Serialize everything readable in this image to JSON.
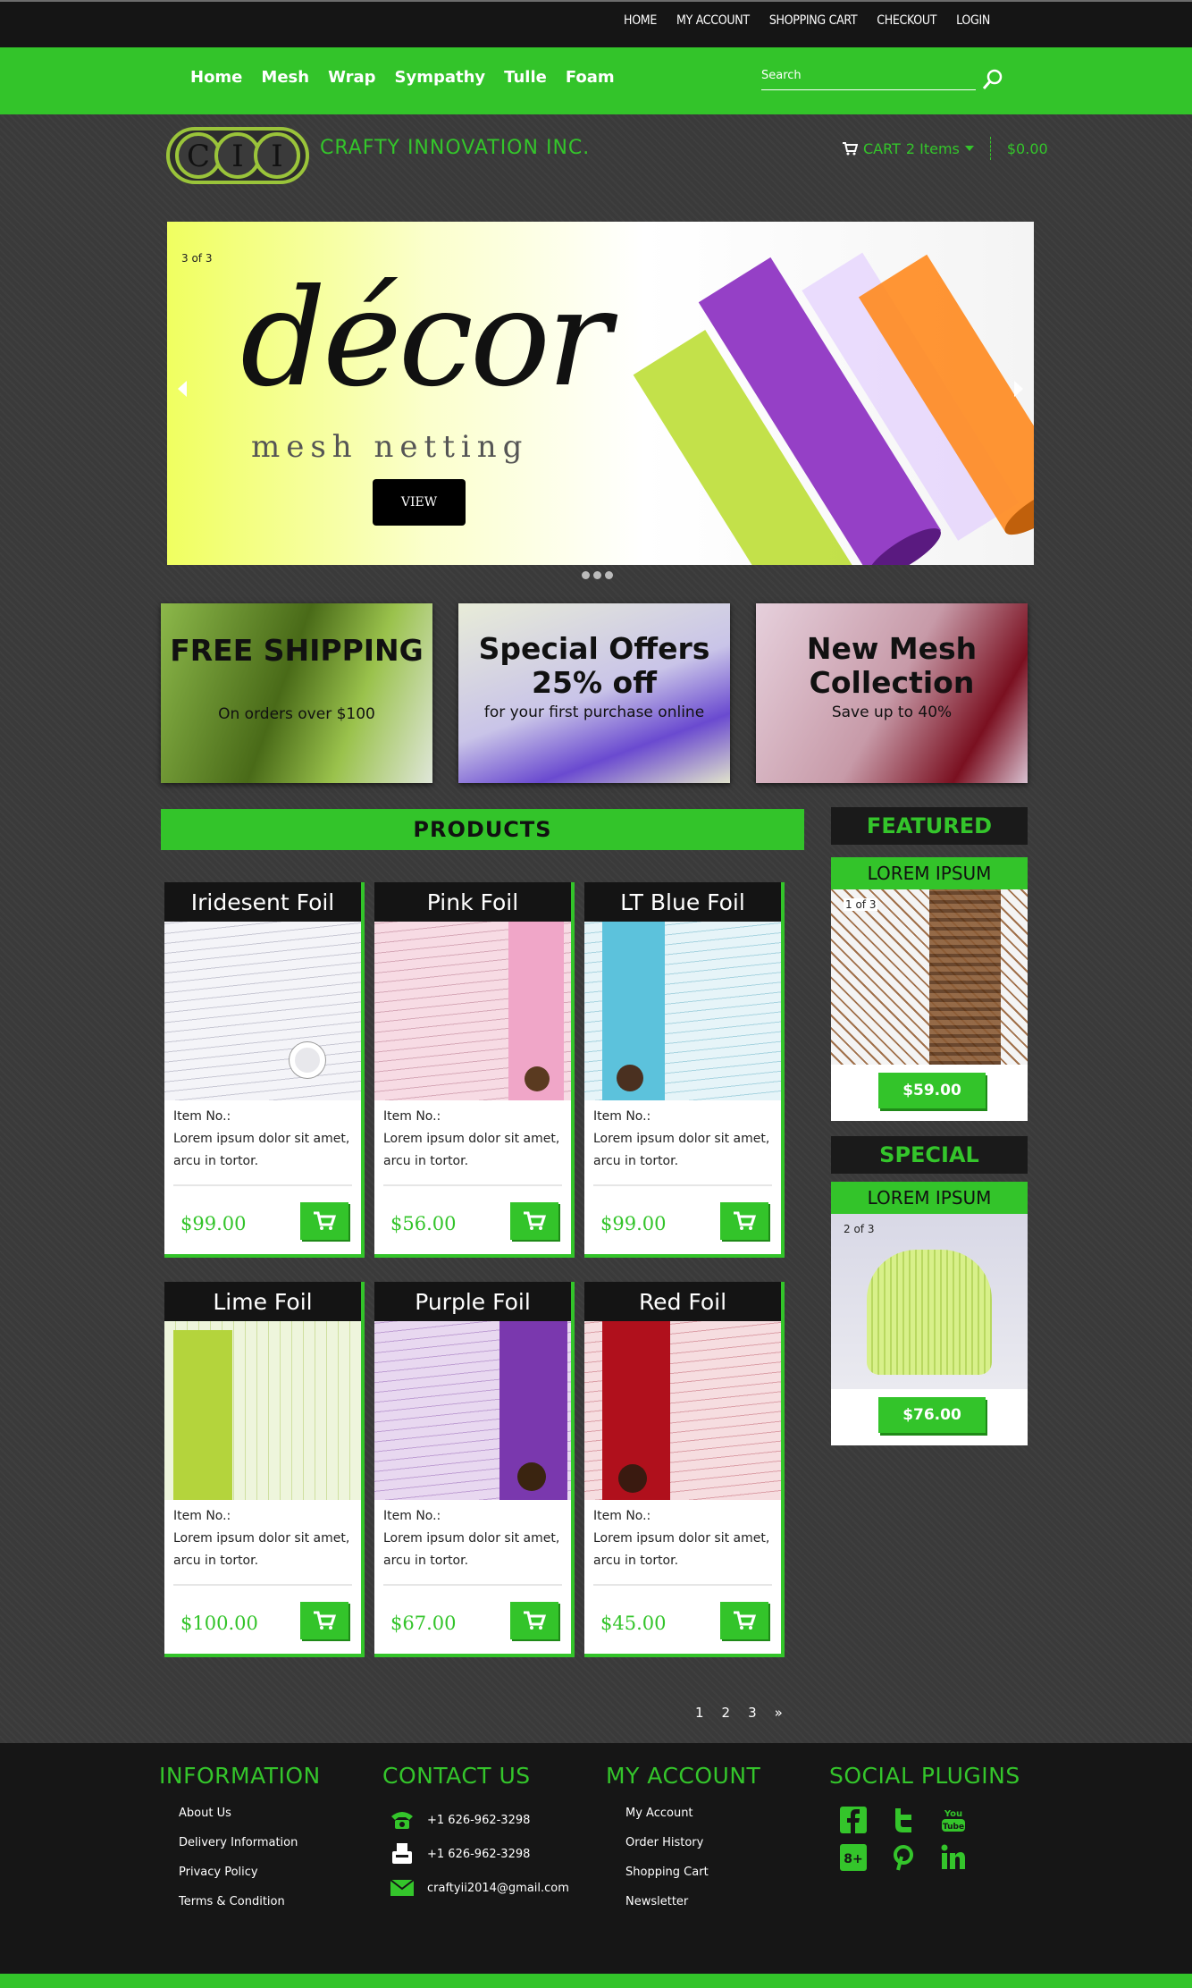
{
  "topbar": {
    "links": [
      "HOME",
      "MY ACCOUNT",
      "SHOPPING CART",
      "CHECKOUT",
      "LOGIN"
    ]
  },
  "nav": {
    "menu": [
      "Home",
      "Mesh",
      "Wrap",
      "Sympathy",
      "Tulle",
      "Foam"
    ],
    "search_placeholder": "Search"
  },
  "header": {
    "logo_text": "CII",
    "brand": "CRAFTY INNOVATION INC.",
    "cart_label": "CART",
    "cart_items": "2 Items",
    "cart_total": "$0.00"
  },
  "slider": {
    "counter": "3 of 3",
    "headline": "décor",
    "subline": "mesh netting",
    "button": "VIEW"
  },
  "promos": [
    {
      "title": "FREE SHIPPING",
      "sub": "On orders over $100"
    },
    {
      "title": "Special Offers 25% off",
      "sub": "for your first purchase online"
    },
    {
      "title": "New Mesh Collection",
      "sub": "Save up to 40%"
    }
  ],
  "products_heading": "PRODUCTS",
  "products": [
    {
      "name": "Iridesent Foil",
      "item_label": "Item No.:",
      "desc": "Lorem ipsum dolor sit amet, arcu in tortor.",
      "price": "$99.00",
      "color": "#d8d8e0"
    },
    {
      "name": "Pink Foil",
      "item_label": "Item No.:",
      "desc": "Lorem ipsum dolor sit amet, arcu in tortor.",
      "price": "$56.00",
      "color": "#e8a3c0"
    },
    {
      "name": "LT Blue Foil",
      "item_label": "Item No.:",
      "desc": "Lorem ipsum dolor sit amet, arcu in tortor.",
      "price": "$99.00",
      "color": "#6ccbe0"
    },
    {
      "name": "Lime Foil",
      "item_label": "Item No.:",
      "desc": "Lorem ipsum dolor sit amet, arcu in tortor.",
      "price": "$100.00",
      "color": "#b7d840"
    },
    {
      "name": "Purple Foil",
      "item_label": "Item No.:",
      "desc": "Lorem ipsum dolor sit amet, arcu in tortor.",
      "price": "$67.00",
      "color": "#7c3ab0"
    },
    {
      "name": "Red Foil",
      "item_label": "Item No.:",
      "desc": "Lorem ipsum dolor sit amet, arcu in tortor.",
      "price": "$45.00",
      "color": "#b01018"
    }
  ],
  "sidebar": {
    "featured": {
      "heading": "FEATURED",
      "label": "LOREM IPSUM",
      "counter": "1 of 3",
      "price": "$59.00"
    },
    "special": {
      "heading": "SPECIAL",
      "label": "LOREM IPSUM",
      "counter": "2 of 3",
      "price": "$76.00"
    }
  },
  "pagination": [
    "1",
    "2",
    "3",
    "»"
  ],
  "footer": {
    "information": {
      "heading": "INFORMATION",
      "links": [
        "About Us",
        "Delivery Information",
        "Privacy Policy",
        "Terms & Condition"
      ]
    },
    "contact": {
      "heading": "CONTACT US",
      "phone": "+1 626-962-3298",
      "fax": "+1 626-962-3298",
      "email": "craftyii2014@gmail.com"
    },
    "account": {
      "heading": "MY ACCOUNT",
      "links": [
        "My Account",
        "Order History",
        "Shopping Cart",
        "Newsletter"
      ]
    },
    "social": {
      "heading": "SOCIAL PLUGINS",
      "icons": [
        "facebook-icon",
        "twitter-icon",
        "youtube-icon",
        "google-plus-icon",
        "pinterest-icon",
        "linkedin-icon"
      ]
    }
  },
  "colors": {
    "accent": "#33c42a",
    "dark": "#151515",
    "background": "#3a3a3a"
  }
}
